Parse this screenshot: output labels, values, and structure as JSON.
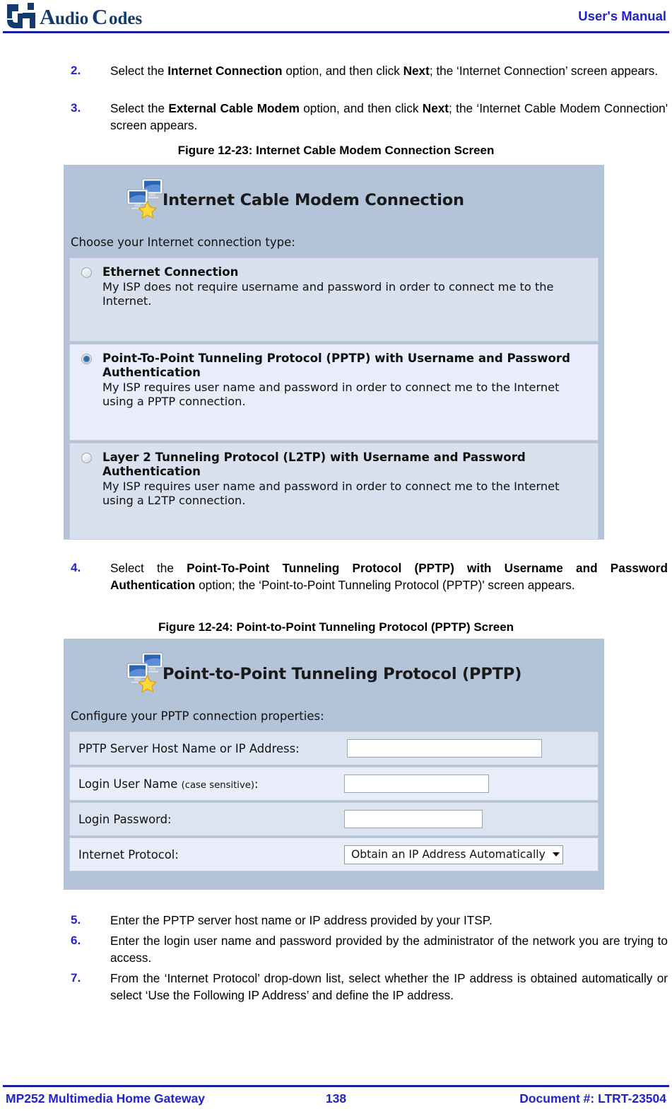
{
  "header": {
    "logo_text": "AudioCodes",
    "logo_icon": "audiocodes-logo-icon",
    "right_label": "User's Manual"
  },
  "steps": [
    {
      "number": "2.",
      "segments": [
        {
          "t": "Select the ",
          "b": false
        },
        {
          "t": "Internet Connection",
          "b": true
        },
        {
          "t": " option, and then click ",
          "b": false
        },
        {
          "t": "Next",
          "b": true
        },
        {
          "t": "; the ‘Internet Connection’ screen appears.",
          "b": false
        }
      ]
    },
    {
      "number": "3.",
      "segments": [
        {
          "t": "Select the ",
          "b": false
        },
        {
          "t": "External Cable Modem",
          "b": true
        },
        {
          "t": " option, and then click ",
          "b": false
        },
        {
          "t": "Next",
          "b": true
        },
        {
          "t": "; the ‘Internet Cable Modem Connection' screen appears.",
          "b": false
        }
      ]
    },
    {
      "number": "4.",
      "segments": [
        {
          "t": "Select the ",
          "b": false
        },
        {
          "t": "Point-To-Point Tunneling Protocol (PPTP) with Username and Password Authentication",
          "b": true
        },
        {
          "t": " option; the ‘Point-to-Point Tunneling Protocol (PPTP)' screen appears.",
          "b": false
        }
      ]
    },
    {
      "number": "5.",
      "segments": [
        {
          "t": "Enter the PPTP server host name or IP address provided by your ITSP.",
          "b": false
        }
      ]
    },
    {
      "number": "6.",
      "segments": [
        {
          "t": "Enter the login user name and password provided by the administrator of the network you are trying to access.",
          "b": false
        }
      ]
    },
    {
      "number": "7.",
      "segments": [
        {
          "t": "From the ‘Internet Protocol’ drop-down list, select whether the IP address is obtained automatically or select ‘Use the Following IP Address’ and define the IP address.",
          "b": false
        }
      ]
    }
  ],
  "figure_1": {
    "caption": "Figure 12-23: Internet Cable Modem Connection Screen",
    "title": "Internet Cable Modem Connection",
    "icon": "network-computers-star-icon",
    "subtitle": "Choose your Internet connection type:",
    "options": [
      {
        "title": "Ethernet Connection",
        "description": "My ISP does not require username and password in order to connect me to the Internet.",
        "selected": false
      },
      {
        "title": "Point-To-Point Tunneling Protocol (PPTP) with Username and Password Authentication",
        "description": "My ISP requires user name and password in order to connect me to the Internet using a PPTP connection.",
        "selected": true
      },
      {
        "title": "Layer 2 Tunneling Protocol (L2TP) with Username and Password Authentication",
        "description": "My ISP requires user name and password in order to connect me to the Internet using a L2TP connection.",
        "selected": false
      }
    ]
  },
  "figure_2": {
    "caption": "Figure 12-24: Point-to-Point Tunneling Protocol (PPTP) Screen",
    "title": "Point-to-Point Tunneling Protocol (PPTP)",
    "icon": "network-computers-star-icon",
    "subtitle": "Configure your PPTP connection properties:",
    "rows": [
      {
        "label": "PPTP Server Host Name or IP Address:",
        "label_small": "",
        "type": "text",
        "value": ""
      },
      {
        "label": "Login User Name ",
        "label_small": "(case sensitive)",
        "label_tail": ":",
        "type": "text",
        "value": ""
      },
      {
        "label": "Login Password:",
        "label_small": "",
        "type": "text",
        "value": ""
      },
      {
        "label": "Internet Protocol:",
        "label_small": "",
        "type": "select",
        "value": "Obtain an IP Address Automatically"
      }
    ]
  },
  "footer": {
    "left": "MP252 Multimedia Home Gateway",
    "page_number": "138",
    "right": "Document #: LTRT-23504"
  },
  "colors": {
    "accent_blue": "#2222cc",
    "rule_blue": "#1a1aa8",
    "shot_header_bg": "#b4c4d8",
    "panel_bg": "#d9e1ef",
    "panel_selected_bg": "#e9edfb"
  }
}
